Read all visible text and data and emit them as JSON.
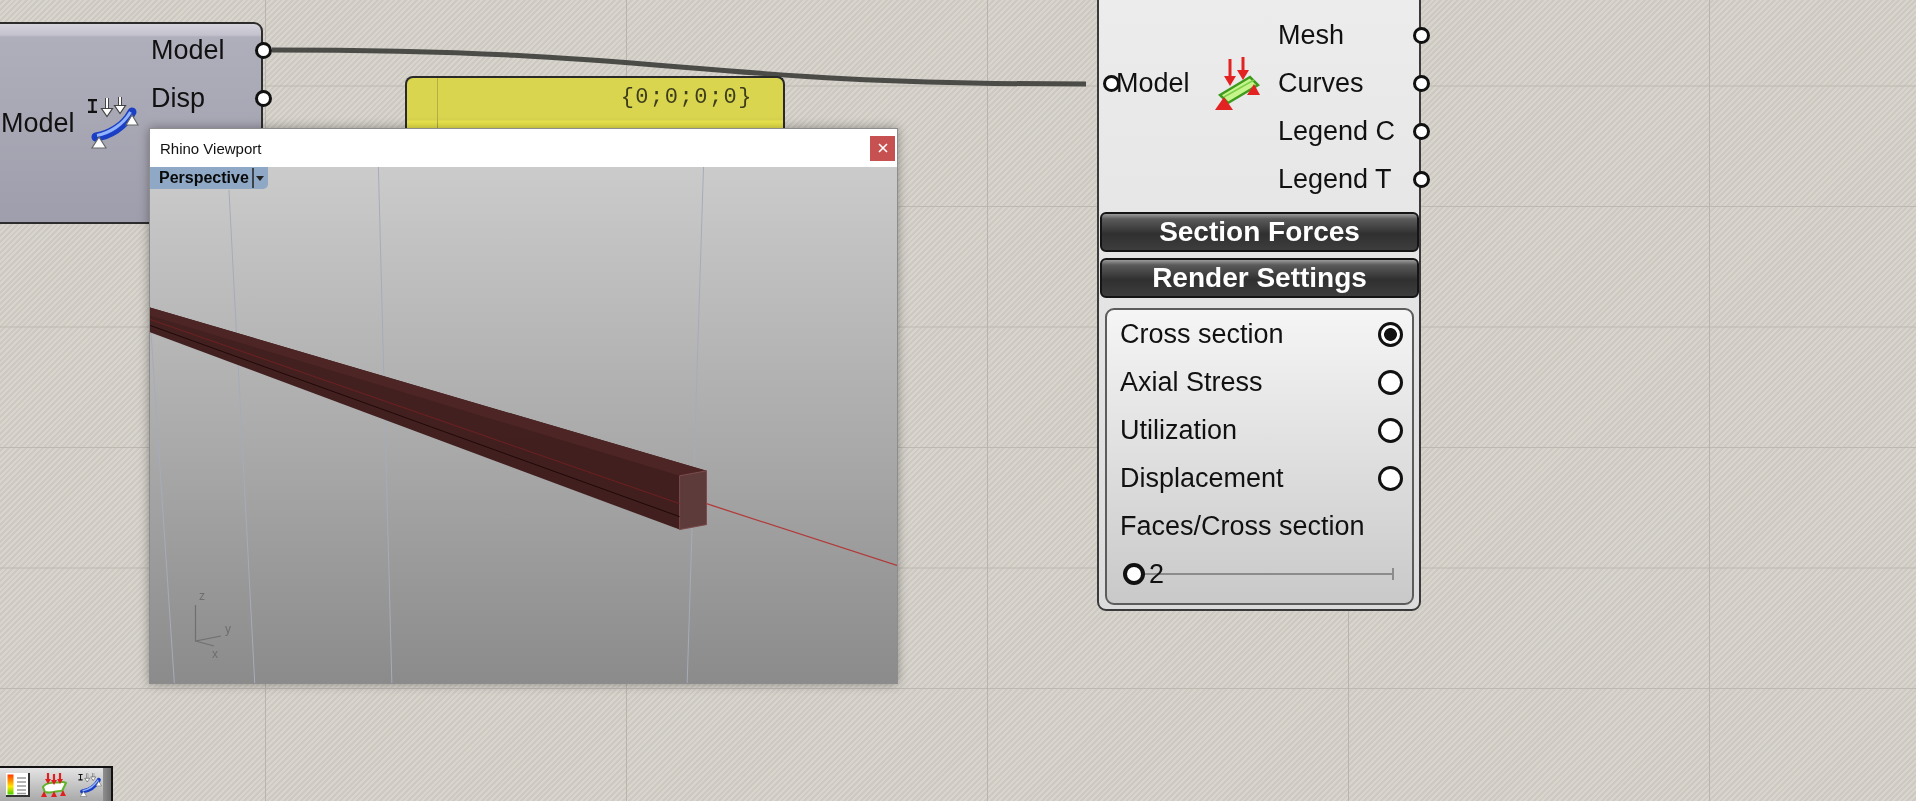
{
  "left_component": {
    "inputs": [
      "Model"
    ],
    "outputs": [
      "Model",
      "Disp"
    ]
  },
  "panel": {
    "text": "{0;0;0;0}"
  },
  "right_component": {
    "inputs": [
      "Model"
    ],
    "outputs": [
      "Mesh",
      "Curves",
      "Legend C",
      "Legend T"
    ],
    "sections": [
      "Section Forces",
      "Render Settings"
    ],
    "render_options": [
      {
        "label": "Cross section",
        "selected": true
      },
      {
        "label": "Axial Stress",
        "selected": false
      },
      {
        "label": "Utilization",
        "selected": false
      },
      {
        "label": "Displacement",
        "selected": false
      }
    ],
    "slider": {
      "label": "Faces/Cross section",
      "value": "2",
      "level": 0
    }
  },
  "viewport_window": {
    "title": "Rhino Viewport",
    "view": "Perspective",
    "axis_labels": [
      "z",
      "y",
      "x"
    ]
  }
}
